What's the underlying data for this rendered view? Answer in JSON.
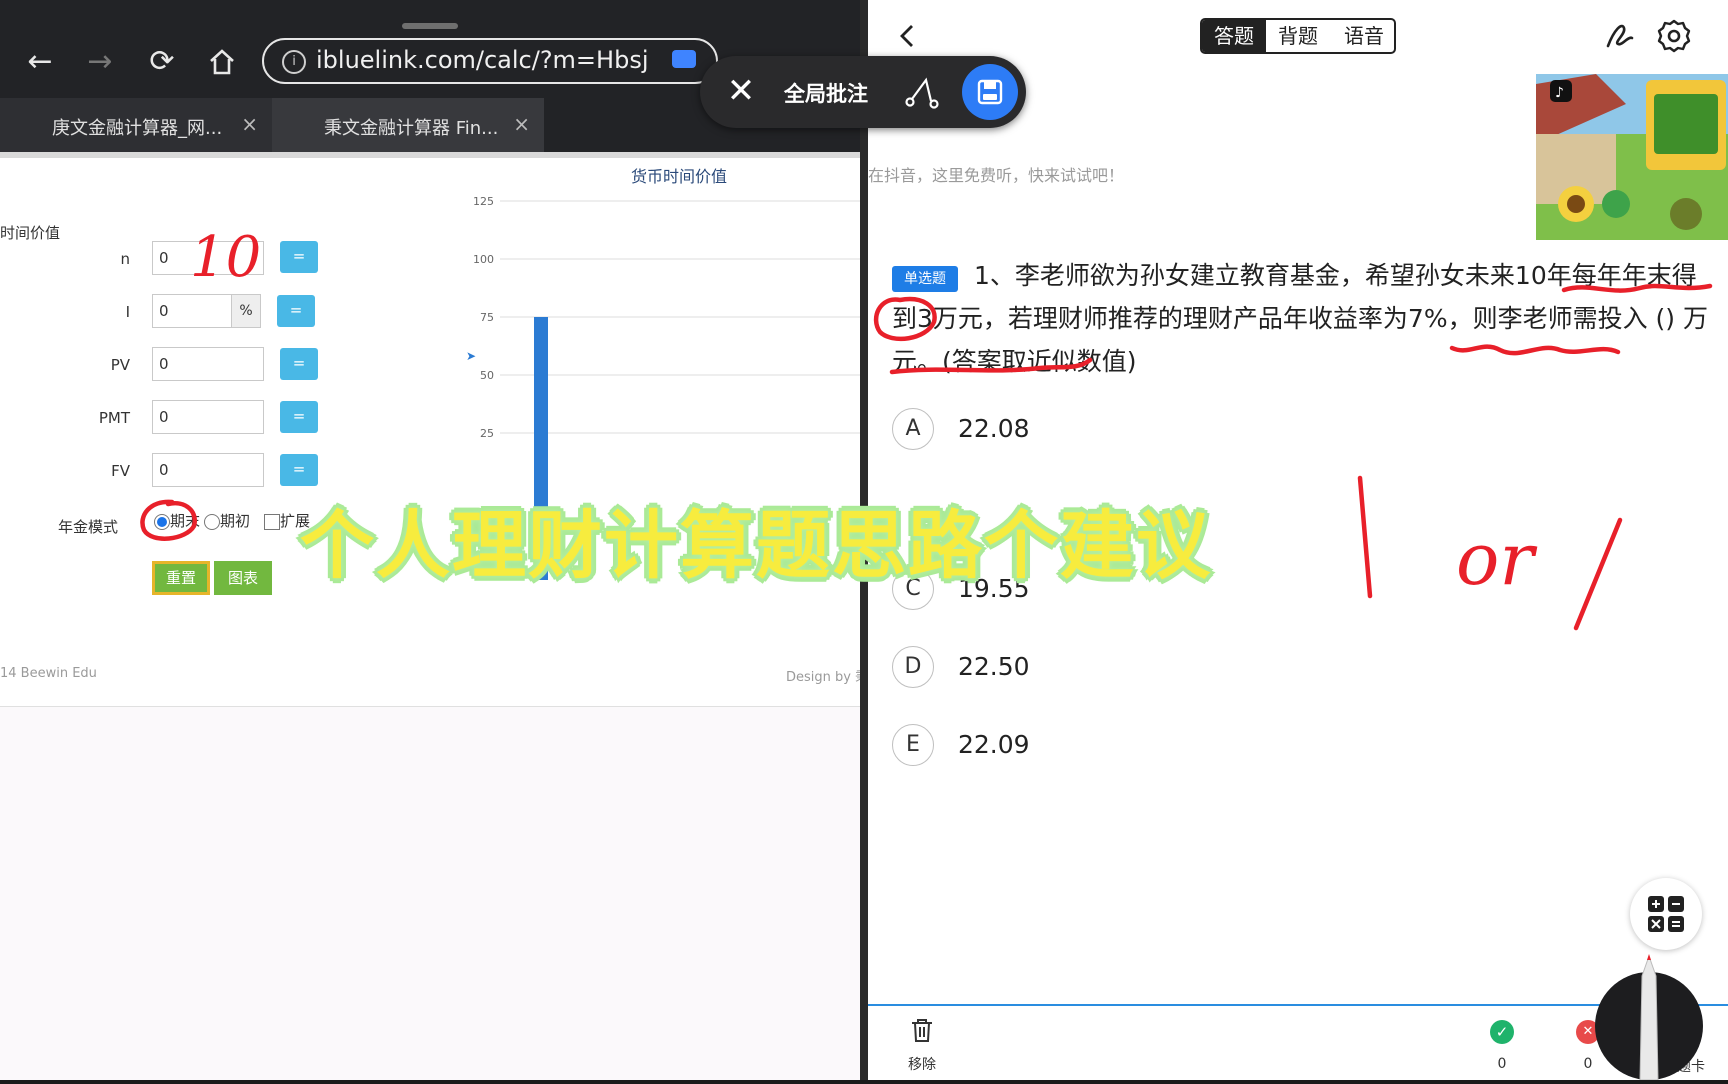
{
  "browser": {
    "url": "ibluelink.com/calc/?m=Hbsj",
    "tabs": [
      {
        "label": "庚文金融计算器_网..."
      },
      {
        "label": "秉文金融计算器 Fin..."
      }
    ],
    "close_glyph": "×"
  },
  "annotation_toolbar": {
    "label": "全局批注"
  },
  "calculator": {
    "section_title": "时间价值",
    "rows": [
      {
        "label": "n",
        "value": "0",
        "button": "="
      },
      {
        "label": "I",
        "value": "0",
        "suffix": "%",
        "button": "="
      },
      {
        "label": "PV",
        "value": "0",
        "button": "="
      },
      {
        "label": "PMT",
        "value": "0",
        "button": "="
      },
      {
        "label": "FV",
        "value": "0",
        "button": "="
      }
    ],
    "annuity_mode_label": "年金模式",
    "option_end": "期末",
    "option_begin": "期初",
    "option_expand": "扩展",
    "reset_button": "重置",
    "chart_button": "图表",
    "footer_left": "14 Beewin Edu",
    "footer_right": "Design by 秉"
  },
  "chart_data": {
    "type": "bar",
    "title": "货币时间价值",
    "ylim": [
      0,
      125
    ],
    "yticks": [
      "125",
      "100",
      "75",
      "50",
      "25"
    ],
    "categories": [
      ""
    ],
    "values": [
      75
    ],
    "colors": {
      "bar": "#2b7bd3"
    }
  },
  "quiz": {
    "mode_tabs": [
      "答题",
      "背题",
      "语音"
    ],
    "ad_text": "在抖音，这里免费听，快来试试吧！",
    "question_type": "单选题",
    "question_text": "1、李老师欲为孙女建立教育基金，希望孙女未来10年每年年末得到3万元，若理财师推荐的理财产品年收益率为7%，则李老师需投入 () 万元。(答案取近似数值)",
    "options": [
      {
        "letter": "A",
        "value": "22.08"
      },
      {
        "letter": "C",
        "value": "19.55"
      },
      {
        "letter": "D",
        "value": "22.50"
      },
      {
        "letter": "E",
        "value": "22.09"
      }
    ],
    "bottom_bar": {
      "remove_label": "移除",
      "correct_count": "0",
      "wrong_count": "0",
      "answer_card_label": "答题卡"
    }
  },
  "overlay": {
    "title": "个人理财计算题思路个建议",
    "handwriting_n": "10",
    "handwriting_or": "or"
  },
  "accent_colors": {
    "ink": "#e8202a",
    "primary": "#1e7de6",
    "highlight": "#f7ec3e"
  }
}
